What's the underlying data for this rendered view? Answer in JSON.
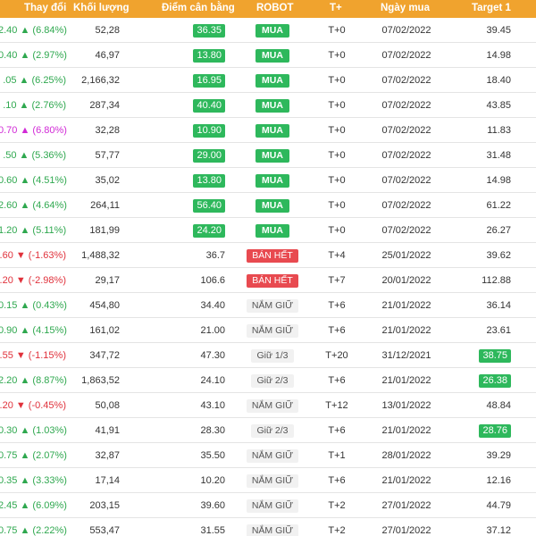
{
  "columns": {
    "change": "Thay đổi",
    "volume": "Khối lượng",
    "equilibrium": "Điểm cân bằng",
    "robot": "ROBOT",
    "tplus": "T+",
    "buy_date": "Ngày mua",
    "target": "Target 1"
  },
  "colors": {
    "header": "#f0a32e",
    "up": "#2fa84f",
    "down": "#e0323c",
    "ceiling": "#d12ad6",
    "buy": "#2eb85c",
    "sell": "#e84a50",
    "hold": "#f1f1f1"
  },
  "rows": [
    {
      "change": "2.40 ▲ (6.84%)",
      "dir": "up",
      "volume": "52,28",
      "equilibrium": "36.35",
      "eq_badge": true,
      "robot": "MUA",
      "signal": "buy",
      "tplus": "T+0",
      "date": "07/02/2022",
      "target": "39.45",
      "target_badge": false
    },
    {
      "change": "0.40 ▲ (2.97%)",
      "dir": "up",
      "volume": "46,97",
      "equilibrium": "13.80",
      "eq_badge": true,
      "robot": "MUA",
      "signal": "buy",
      "tplus": "T+0",
      "date": "07/02/2022",
      "target": "14.98",
      "target_badge": false
    },
    {
      ".change": "",
      "change": ".05 ▲ (6.25%)",
      "dir": "up",
      "volume": "2,166,32",
      "equilibrium": "16.95",
      "eq_badge": true,
      "robot": "MUA",
      "signal": "buy",
      "tplus": "T+0",
      "date": "07/02/2022",
      "target": "18.40",
      "target_badge": false
    },
    {
      "change": ".10 ▲ (2.76%)",
      "dir": "up",
      "volume": "287,34",
      "equilibrium": "40.40",
      "eq_badge": true,
      "robot": "MUA",
      "signal": "buy",
      "tplus": "T+0",
      "date": "07/02/2022",
      "target": "43.85",
      "target_badge": false
    },
    {
      "change": "0.70 ▲ (6.80%)",
      "dir": "ceil",
      "volume": "32,28",
      "equilibrium": "10.90",
      "eq_badge": true,
      "robot": "MUA",
      "signal": "buy",
      "tplus": "T+0",
      "date": "07/02/2022",
      "target": "11.83",
      "target_badge": false
    },
    {
      "change": ".50 ▲ (5.36%)",
      "dir": "up",
      "volume": "57,77",
      "equilibrium": "29.00",
      "eq_badge": true,
      "robot": "MUA",
      "signal": "buy",
      "tplus": "T+0",
      "date": "07/02/2022",
      "target": "31.48",
      "target_badge": false
    },
    {
      "change": "0.60 ▲ (4.51%)",
      "dir": "up",
      "volume": "35,02",
      "equilibrium": "13.80",
      "eq_badge": true,
      "robot": "MUA",
      "signal": "buy",
      "tplus": "T+0",
      "date": "07/02/2022",
      "target": "14.98",
      "target_badge": false
    },
    {
      "change": "2.60 ▲ (4.64%)",
      "dir": "up",
      "volume": "264,11",
      "equilibrium": "56.40",
      "eq_badge": true,
      "robot": "MUA",
      "signal": "buy",
      "tplus": "T+0",
      "date": "07/02/2022",
      "target": "61.22",
      "target_badge": false
    },
    {
      "change": "1.20 ▲ (5.11%)",
      "dir": "up",
      "volume": "181,99",
      "equilibrium": "24.20",
      "eq_badge": true,
      "robot": "MUA",
      "signal": "buy",
      "tplus": "T+0",
      "date": "07/02/2022",
      "target": "26.27",
      "target_badge": false
    },
    {
      "change": ".60 ▼ (-1.63%)",
      "dir": "down",
      "volume": "1,488,32",
      "equilibrium": "36.7",
      "eq_badge": false,
      "robot": "BÁN HẾT",
      "signal": "sell",
      "tplus": "T+4",
      "date": "25/01/2022",
      "target": "39.62",
      "target_badge": false
    },
    {
      "change": ".20 ▼ (-2.98%)",
      "dir": "down",
      "volume": "29,17",
      "equilibrium": "106.6",
      "eq_badge": false,
      "robot": "BÁN HẾT",
      "signal": "sell",
      "tplus": "T+7",
      "date": "20/01/2022",
      "target": "112.88",
      "target_badge": false
    },
    {
      "change": "0.15 ▲ (0.43%)",
      "dir": "up",
      "volume": "454,80",
      "equilibrium": "34.40",
      "eq_badge": false,
      "robot": "NẮM GIỮ",
      "signal": "hold",
      "tplus": "T+6",
      "date": "21/01/2022",
      "target": "36.14",
      "target_badge": false
    },
    {
      "change": "0.90 ▲ (4.15%)",
      "dir": "up",
      "volume": "161,02",
      "equilibrium": "21.00",
      "eq_badge": false,
      "robot": "NẮM GIỮ",
      "signal": "hold",
      "tplus": "T+6",
      "date": "21/01/2022",
      "target": "23.61",
      "target_badge": false
    },
    {
      "change": ".55 ▼ (-1.15%)",
      "dir": "down",
      "volume": "347,72",
      "equilibrium": "47.30",
      "eq_badge": false,
      "robot": "Giữ 1/3",
      "signal": "hold",
      "tplus": "T+20",
      "date": "31/12/2021",
      "target": "38.75",
      "target_badge": true
    },
    {
      "change": "2.20 ▲ (8.87%)",
      "dir": "up",
      "volume": "1,863,52",
      "equilibrium": "24.10",
      "eq_badge": false,
      "robot": "Giữ 2/3",
      "signal": "hold",
      "tplus": "T+6",
      "date": "21/01/2022",
      "target": "26.38",
      "target_badge": true
    },
    {
      "change": ".20 ▼ (-0.45%)",
      "dir": "down",
      "volume": "50,08",
      "equilibrium": "43.10",
      "eq_badge": false,
      "robot": "NẮM GIỮ",
      "signal": "hold",
      "tplus": "T+12",
      "date": "13/01/2022",
      "target": "48.84",
      "target_badge": false
    },
    {
      "change": "0.30 ▲ (1.03%)",
      "dir": "up",
      "volume": "41,91",
      "equilibrium": "28.30",
      "eq_badge": false,
      "robot": "Giữ 2/3",
      "signal": "hold",
      "tplus": "T+6",
      "date": "21/01/2022",
      "target": "28.76",
      "target_badge": true
    },
    {
      "change": "0.75 ▲ (2.07%)",
      "dir": "up",
      "volume": "32,87",
      "equilibrium": "35.50",
      "eq_badge": false,
      "robot": "NẮM GIỮ",
      "signal": "hold",
      "tplus": "T+1",
      "date": "28/01/2022",
      "target": "39.29",
      "target_badge": false
    },
    {
      "change": "0.35 ▲ (3.33%)",
      "dir": "up",
      "volume": "17,14",
      "equilibrium": "10.20",
      "eq_badge": false,
      "robot": "NẮM GIỮ",
      "signal": "hold",
      "tplus": "T+6",
      "date": "21/01/2022",
      "target": "12.16",
      "target_badge": false
    },
    {
      "change": "2.45 ▲ (6.09%)",
      "dir": "up",
      "volume": "203,15",
      "equilibrium": "39.60",
      "eq_badge": false,
      "robot": "NẮM GIỮ",
      "signal": "hold",
      "tplus": "T+2",
      "date": "27/01/2022",
      "target": "44.79",
      "target_badge": false
    },
    {
      "change": "0.75 ▲ (2.22%)",
      "dir": "up",
      "volume": "553,47",
      "equilibrium": "31.55",
      "eq_badge": false,
      "robot": "NẮM GIỮ",
      "signal": "hold",
      "tplus": "T+2",
      "date": "27/01/2022",
      "target": "37.12",
      "target_badge": false
    }
  ]
}
